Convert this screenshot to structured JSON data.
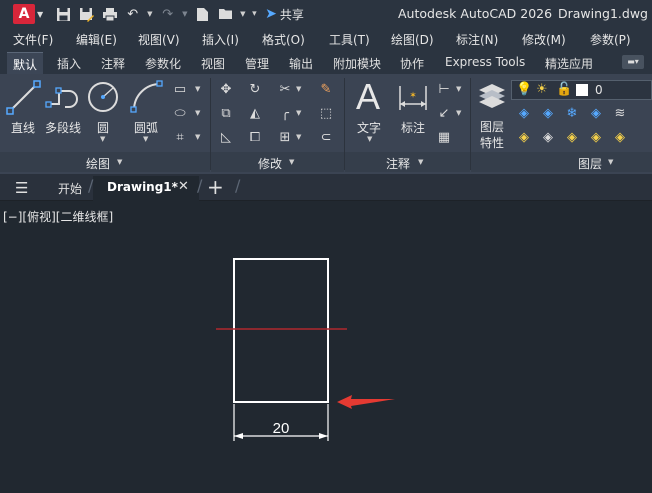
{
  "titlebar": {
    "logo": "A",
    "quick_access_icons": [
      "save-icon",
      "save-as-icon",
      "print-icon",
      "undo-icon",
      "redo-icon",
      "new-icon",
      "open-icon"
    ],
    "share_label": "共享",
    "app_title": "Autodesk AutoCAD 2026",
    "file_title": "Drawing1.dwg"
  },
  "menu": {
    "items": [
      "文件(F)",
      "编辑(E)",
      "视图(V)",
      "插入(I)",
      "格式(O)",
      "工具(T)",
      "绘图(D)",
      "标注(N)",
      "修改(M)",
      "参数(P)"
    ]
  },
  "ribbon_tabs": {
    "items": [
      "默认",
      "插入",
      "注释",
      "参数化",
      "视图",
      "管理",
      "输出",
      "附加模块",
      "协作",
      "Express Tools",
      "精选应用"
    ],
    "active": "默认"
  },
  "ribbon": {
    "draw": {
      "title": "绘图",
      "line": "直线",
      "polyline": "多段线",
      "circle": "圆",
      "arc": "圆弧"
    },
    "modify": {
      "title": "修改"
    },
    "annotation": {
      "title": "注释",
      "text": "文字",
      "dimension": "标注"
    },
    "layers": {
      "title": "图层",
      "properties_line1": "图层",
      "properties_line2": "特性",
      "current_layer": "0"
    }
  },
  "file_tabs": {
    "items": [
      "开始",
      "Drawing1*"
    ],
    "active": "Drawing1*"
  },
  "viewport": {
    "view_controls": "[−][俯视][二维线框]",
    "dimension_value": "20",
    "colors": {
      "background": "#212830",
      "geometry": "#ffffff",
      "axis_line": "#b0282d",
      "arrow": "#e53a32"
    }
  }
}
